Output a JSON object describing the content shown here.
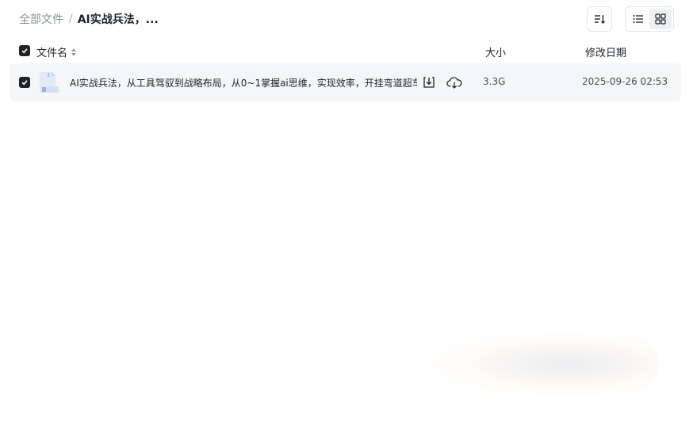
{
  "breadcrumb": {
    "root": "全部文件",
    "separator": "/",
    "current": "AI实战兵法，..."
  },
  "toolbar": {
    "sort_icon": "sort-icon",
    "view_list_icon": "list-view-icon",
    "view_grid_icon": "grid-view-icon",
    "active_view": "list"
  },
  "table": {
    "columns": {
      "name": "文件名",
      "size": "大小",
      "date": "修改日期"
    },
    "header_checked": true,
    "rows": [
      {
        "checked": true,
        "icon": "folder-doc-icon",
        "name": "AI实战兵法，从工具驾驭到战略布局，从0~1掌握ai思维，实现效率，开挂弯道超车",
        "size": "3.3G",
        "date": "2025-09-26 02:53",
        "actions": [
          "download-icon",
          "cloud-save-icon"
        ]
      }
    ]
  },
  "colors": {
    "text_primary": "#1f2329",
    "text_secondary": "#8a8f99",
    "row_background": "#f5f6f7",
    "checkbox": "#1f2329",
    "border": "#e3e5e8"
  }
}
